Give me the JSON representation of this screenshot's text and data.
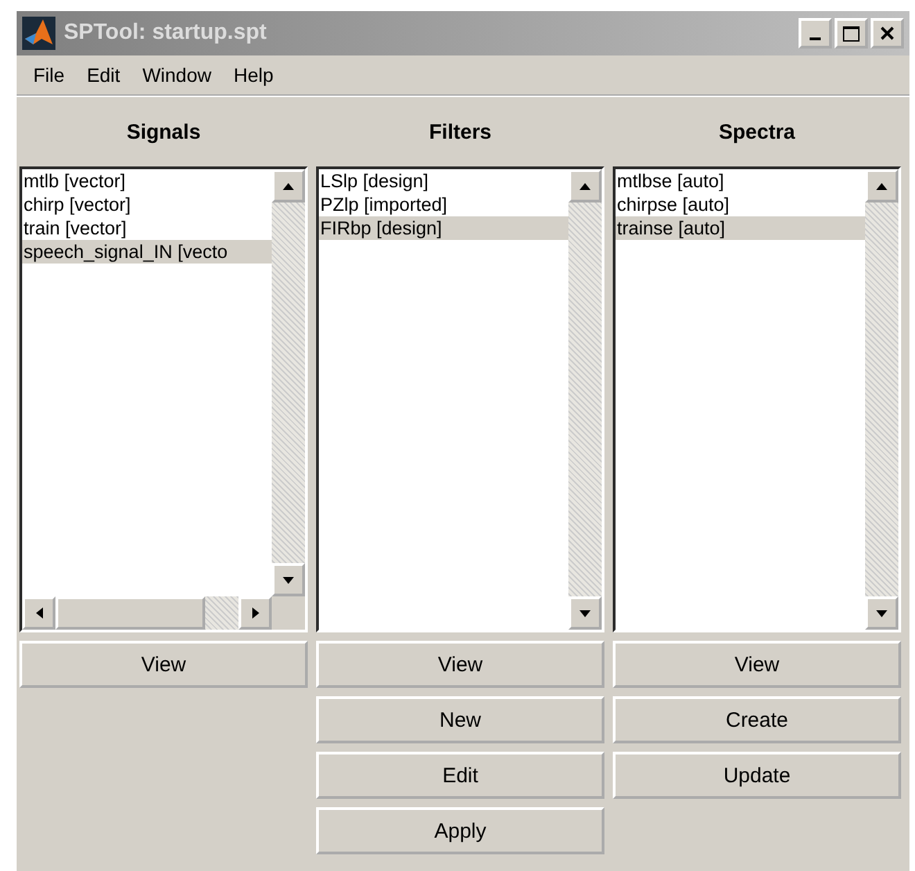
{
  "window": {
    "title": "SPTool: startup.spt"
  },
  "menu": [
    "File",
    "Edit",
    "Window",
    "Help"
  ],
  "columns": [
    {
      "heading": "Signals",
      "horizontal_scrollbar": true,
      "items": [
        {
          "label": "mtlb [vector]",
          "selected": false
        },
        {
          "label": "chirp [vector]",
          "selected": false
        },
        {
          "label": "train [vector]",
          "selected": false
        },
        {
          "label": "speech_signal_IN [vecto",
          "selected": true
        }
      ],
      "buttons": [
        "View"
      ]
    },
    {
      "heading": "Filters",
      "horizontal_scrollbar": false,
      "items": [
        {
          "label": "LSlp [design]",
          "selected": false
        },
        {
          "label": "PZlp [imported]",
          "selected": false
        },
        {
          "label": "FIRbp [design]",
          "selected": true
        }
      ],
      "buttons": [
        "View",
        "New",
        "Edit",
        "Apply"
      ]
    },
    {
      "heading": "Spectra",
      "horizontal_scrollbar": false,
      "items": [
        {
          "label": "mtlbse [auto]",
          "selected": false
        },
        {
          "label": "chirpse [auto]",
          "selected": false
        },
        {
          "label": "trainse [auto]",
          "selected": true
        }
      ],
      "buttons": [
        "View",
        "Create",
        "Update"
      ]
    }
  ]
}
